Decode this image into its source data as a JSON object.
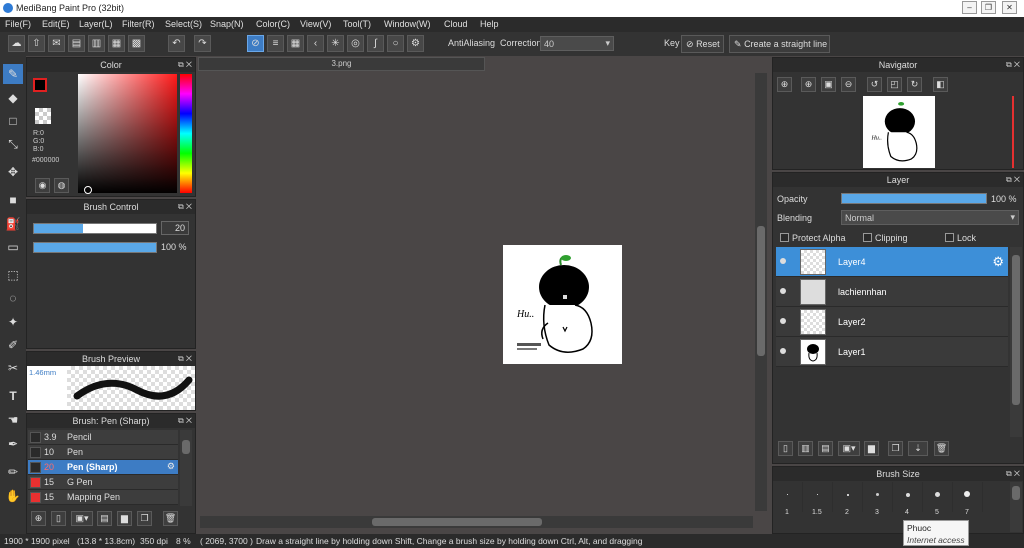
{
  "window": {
    "title": "MediBang Paint Pro (32bit)"
  },
  "menu": [
    "File(F)",
    "Edit(E)",
    "Layer(L)",
    "Filter(R)",
    "Select(S)",
    "Snap(N)",
    "Color(C)",
    "View(V)",
    "Tool(T)",
    "Window(W)",
    "Cloud",
    "Help"
  ],
  "toolbar": {
    "antialiasing": "AntiAliasing",
    "correction_label": "Correction",
    "correction_value": "40",
    "key_label": "Key",
    "reset_label": "Reset",
    "straight_label": "Create a straight line"
  },
  "color_panel": {
    "title": "Color",
    "r": "R:0",
    "g": "G:0",
    "b": "B:0",
    "hex": "#000000"
  },
  "brush_control": {
    "title": "Brush Control",
    "size": "20",
    "opacity": "100 %"
  },
  "brush_preview": {
    "title": "Brush Preview",
    "size": "1.46mm"
  },
  "brush_list": {
    "title": "Brush: Pen (Sharp)",
    "items": [
      {
        "size": "3.9",
        "name": "Pencil",
        "color": "#2a2a2a"
      },
      {
        "size": "10",
        "name": "Pen",
        "color": "#2a2a2a"
      },
      {
        "size": "20",
        "name": "Pen (Sharp)",
        "color": "#2a2a2a"
      },
      {
        "size": "15",
        "name": "G Pen",
        "color": "#e83030"
      },
      {
        "size": "15",
        "name": "Mapping Pen",
        "color": "#e83030"
      }
    ]
  },
  "document": {
    "tab": "3.png"
  },
  "navigator": {
    "title": "Navigator"
  },
  "layer_panel": {
    "title": "Layer",
    "opacity_label": "Opacity",
    "opacity_value": "100 %",
    "blending_label": "Blending",
    "blending_value": "Normal",
    "protect_alpha": "Protect Alpha",
    "clipping": "Clipping",
    "lock": "Lock",
    "layers": [
      {
        "name": "Layer4"
      },
      {
        "name": "lachiennhan"
      },
      {
        "name": "Layer2"
      },
      {
        "name": "Layer1"
      }
    ]
  },
  "brush_size": {
    "title": "Brush Size",
    "labels": [
      "1",
      "1.5",
      "2",
      "3",
      "4",
      "5",
      "7"
    ]
  },
  "tooltip": {
    "title": "Phuoc",
    "sub": "Internet access"
  },
  "status": {
    "size": "1900 * 1900 pixel",
    "physical": "(13.8 * 13.8cm)",
    "dpi": "350 dpi",
    "zoom": "8 %",
    "coords": "( 2069, 3700 )",
    "hint": "Draw a straight line by holding down Shift, Change a brush size by holding down Ctrl, Alt, and dragging"
  }
}
